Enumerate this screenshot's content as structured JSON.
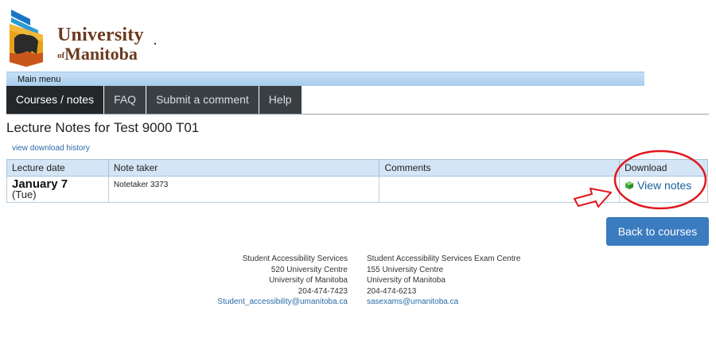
{
  "logo": {
    "line1": "University",
    "line2_of": "of",
    "line2": "Manitoba"
  },
  "menubar": {
    "label": "Main menu"
  },
  "nav": [
    {
      "label": "Courses / notes",
      "active": true
    },
    {
      "label": "FAQ",
      "active": false
    },
    {
      "label": "Submit a comment",
      "active": false
    },
    {
      "label": "Help",
      "active": false
    }
  ],
  "page": {
    "title": "Lecture Notes for Test 9000 T01",
    "history_link": "view download history"
  },
  "table": {
    "headers": {
      "date": "Lecture date",
      "taker": "Note taker",
      "comments": "Comments",
      "download": "Download"
    },
    "rows": [
      {
        "date": "January 7",
        "day": "(Tue)",
        "taker": "Notetaker 3373",
        "comments": "",
        "download": "View notes"
      }
    ]
  },
  "back_button": {
    "label": "Back to courses"
  },
  "footer": {
    "left": {
      "name": "Student Accessibility Services",
      "address": "520 University Centre",
      "org": "University of Manitoba",
      "phone": "204-474-7423",
      "email": "Student_accessibility@umanitoba.ca"
    },
    "right": {
      "name": "Student Accessibility Services Exam Centre",
      "address": "155 University Centre",
      "org": "University of Manitoba",
      "phone": "204-474-6213",
      "email": "sasexams@umanitoba.ca"
    }
  },
  "colors": {
    "brand_brown": "#6b3a1e",
    "nav_dark": "#3a3f44",
    "link_blue": "#2a6aa8",
    "button_blue": "#3b7bbf",
    "annotation_red": "#e0161c"
  },
  "icons": {
    "shield": "university-shield-icon",
    "download": "green-cube-icon",
    "arrow": "red-arrow-icon"
  }
}
